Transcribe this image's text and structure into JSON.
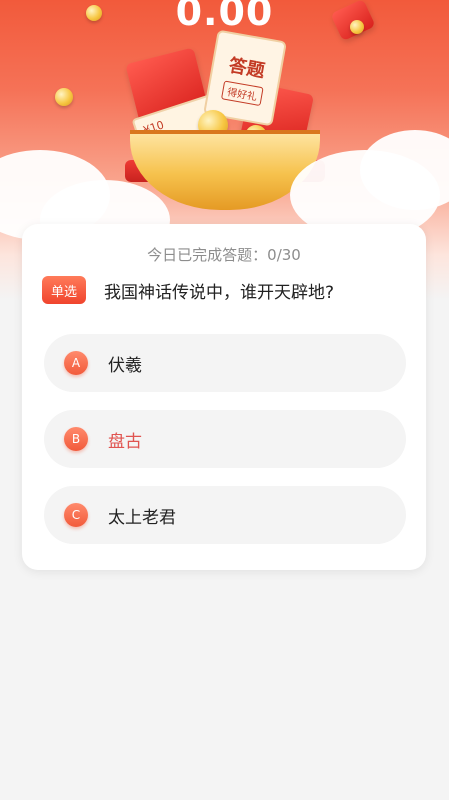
{
  "header": {
    "balance": "0.00"
  },
  "banner": {
    "title": "答题",
    "subtitle": "得好礼",
    "ticket_label": "¥10"
  },
  "quiz": {
    "progress_text": "今日已完成答题：0/30",
    "question_type": "单选",
    "question": "我国神话传说中，谁开天辟地?",
    "options": [
      {
        "letter": "A",
        "text": "伏羲"
      },
      {
        "letter": "B",
        "text": "盘古"
      },
      {
        "letter": "C",
        "text": "太上老君"
      }
    ]
  },
  "colors": {
    "accent": "#f25a3b",
    "highlight_text": "#e05450"
  }
}
